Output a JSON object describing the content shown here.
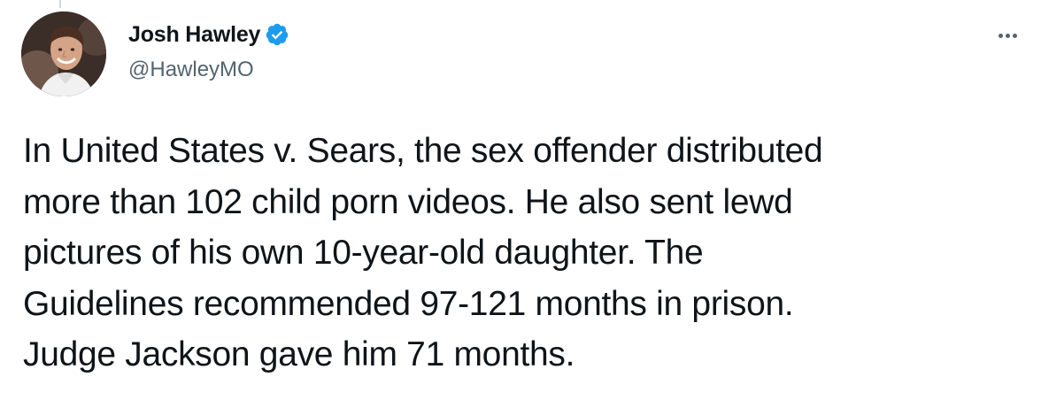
{
  "tweet": {
    "author": {
      "display_name": "Josh Hawley",
      "handle": "@HawleyMO",
      "verified": true,
      "avatar_icon": "profile-photo"
    },
    "more_icon": "more-horizontal-icon",
    "text_lines": [
      "In United States v. Sears, the sex offender distributed",
      "more than 102 child porn videos. He also sent lewd",
      "pictures of his own 10-year-old daughter. The",
      "Guidelines recommended 97-121 months in prison.",
      "Judge Jackson gave him 71 months."
    ]
  },
  "colors": {
    "text": "#0f1419",
    "secondary_text": "#536471",
    "verified_badge": "#1d9bf0",
    "background": "#ffffff"
  }
}
